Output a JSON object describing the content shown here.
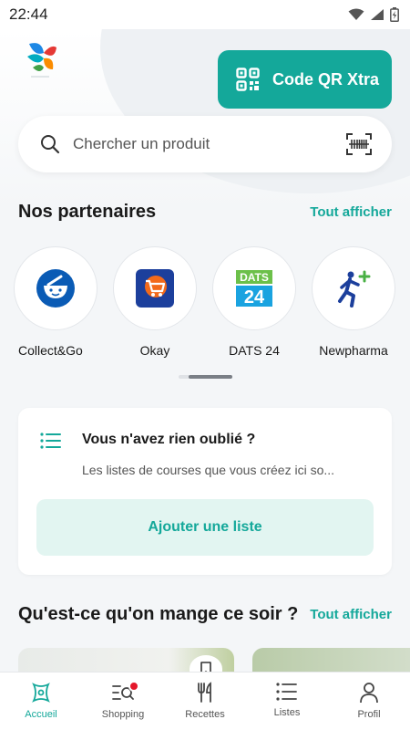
{
  "status_bar": {
    "time": "22:44"
  },
  "header": {
    "qr_button_label": "Code QR Xtra"
  },
  "search": {
    "placeholder": "Chercher un produit"
  },
  "partners_section": {
    "title": "Nos partenaires",
    "show_all": "Tout afficher",
    "items": [
      {
        "label": "Collect&Go",
        "icon": "collect-go-basket-icon"
      },
      {
        "label": "Okay",
        "icon": "okay-cart-icon"
      },
      {
        "label": "DATS 24",
        "icon": "dats24-logo-icon",
        "logo_line1": "DATS",
        "logo_line2": "24"
      },
      {
        "label": "Newpharma",
        "icon": "newpharma-runner-icon"
      }
    ]
  },
  "list_card": {
    "title": "Vous n'avez rien oublié ?",
    "description": "Les listes de courses que vous créez ici so...",
    "button": "Ajouter une liste"
  },
  "recipes_section": {
    "title": "Qu'est-ce qu'on mange ce soir ?",
    "show_all": "Tout afficher"
  },
  "bottom_nav": {
    "items": [
      {
        "label": "Accueil",
        "icon": "home-molecule-icon",
        "active": true
      },
      {
        "label": "Shopping",
        "icon": "shopping-search-icon",
        "badge": true
      },
      {
        "label": "Recettes",
        "icon": "cutlery-icon"
      },
      {
        "label": "Listes",
        "icon": "list-icon"
      },
      {
        "label": "Profil",
        "icon": "profile-icon"
      }
    ]
  },
  "colors": {
    "accent": "#14a89a",
    "accent_light": "#e2f5f1",
    "badge": "#e4172b",
    "background": "#f4f6f8"
  }
}
